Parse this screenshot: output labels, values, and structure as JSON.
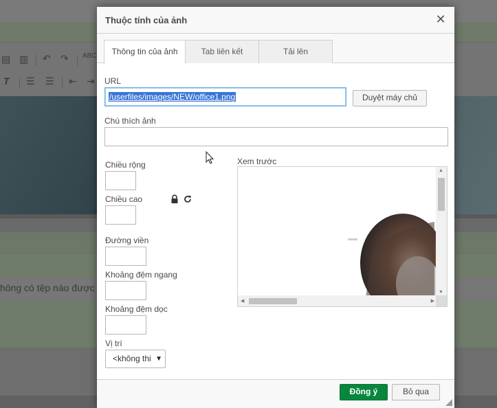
{
  "background": {
    "file_status_text": "hông có tệp nào được"
  },
  "dialog": {
    "title": "Thuộc tính của ảnh",
    "tabs": [
      {
        "label": "Thông tin của ảnh",
        "active": true
      },
      {
        "label": "Tab liên kết",
        "active": false
      },
      {
        "label": "Tải lên",
        "active": false
      }
    ],
    "url": {
      "label": "URL",
      "value": "/userfiles/images/NEW/office1.png",
      "browse_button": "Duyệt máy chủ"
    },
    "caption": {
      "label": "Chú thích ảnh",
      "value": ""
    },
    "width": {
      "label": "Chiều rộng",
      "value": ""
    },
    "height": {
      "label": "Chiều cao",
      "value": ""
    },
    "border": {
      "label": "Đường viền",
      "value": ""
    },
    "hspace": {
      "label": "Khoảng đệm ngang",
      "value": ""
    },
    "vspace": {
      "label": "Khoảng đệm dọc",
      "value": ""
    },
    "align": {
      "label": "Vị trí",
      "selected": "<không thi"
    },
    "preview": {
      "label": "Xem trước"
    },
    "footer": {
      "ok_button": "Đồng ý",
      "cancel_button": "Bỏ qua"
    }
  },
  "colors": {
    "accent_ok": "#09863e",
    "selection": "#3875d7",
    "focus_border": "#66afe9"
  }
}
